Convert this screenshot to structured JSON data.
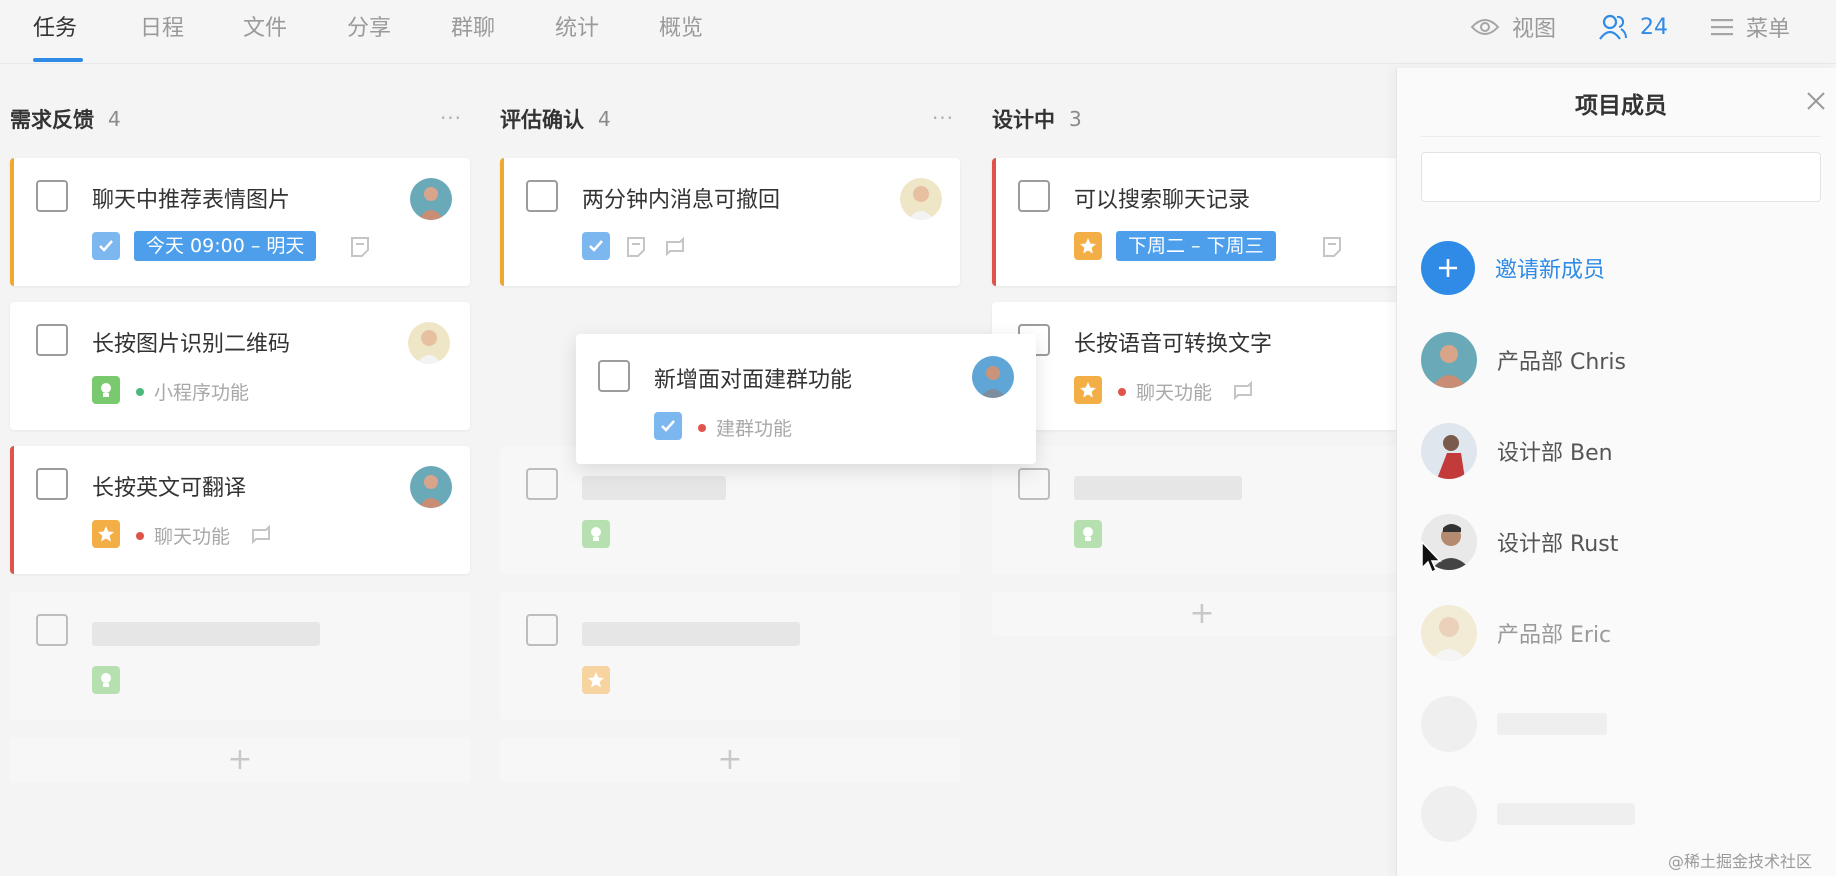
{
  "nav": {
    "tabs": [
      {
        "label": "任务",
        "active": true
      },
      {
        "label": "日程"
      },
      {
        "label": "文件"
      },
      {
        "label": "分享"
      },
      {
        "label": "群聊"
      },
      {
        "label": "统计"
      },
      {
        "label": "概览"
      }
    ],
    "view_label": "视图",
    "members_count": "24",
    "menu_label": "菜单"
  },
  "colors": {
    "accent": "#2f8be6",
    "bar_orange": "#f0a830",
    "bar_red": "#e0534a",
    "tag_green": "#4cb87a",
    "tag_red": "#e0534a"
  },
  "columns": [
    {
      "title": "需求反馈",
      "count": "4",
      "cards": [
        {
          "title": "聊天中推荐表情图片",
          "icon": "check-icon",
          "date": "今天 09:00 – 明天",
          "extras": [
            "note-icon"
          ]
        },
        {
          "title": "长按图片识别二维码",
          "icon": "bulb-icon",
          "tag": "小程序功能",
          "tag_color": "green"
        },
        {
          "title": "长按英文可翻译",
          "icon": "star-icon",
          "tag": "聊天功能",
          "tag_color": "red",
          "extras": [
            "repeat-icon"
          ]
        }
      ]
    },
    {
      "title": "评估确认",
      "count": "4",
      "cards": [
        {
          "title": "两分钟内消息可撤回",
          "icon": "check-icon",
          "extras": [
            "note-icon",
            "repeat-icon"
          ]
        }
      ]
    },
    {
      "title": "设计中",
      "count": "3",
      "cards": [
        {
          "title": "可以搜索聊天记录",
          "icon": "star-icon",
          "date": "下周二 – 下周三",
          "extras": [
            "note-icon"
          ]
        },
        {
          "title": "长按语音可转换文字",
          "icon": "star-icon",
          "tag": "聊天功能",
          "tag_color": "red",
          "extras": [
            "repeat-icon"
          ]
        }
      ]
    }
  ],
  "dragging_card": {
    "title": "新增面对面建群功能",
    "icon": "check-icon",
    "tag": "建群功能",
    "tag_color": "red"
  },
  "panel": {
    "title": "项目成员",
    "search_value": "",
    "invite_label": "邀请新成员",
    "members": [
      {
        "name": "产品部 Chris"
      },
      {
        "name": "设计部 Ben"
      },
      {
        "name": "设计部 Rust"
      },
      {
        "name": "产品部 Eric"
      }
    ]
  },
  "watermark": "@稀土掘金技术社区"
}
